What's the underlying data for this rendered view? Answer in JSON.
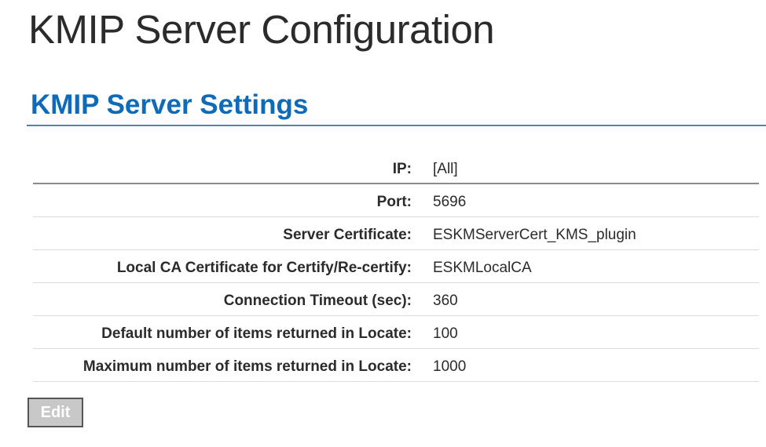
{
  "page": {
    "title": "KMIP Server Configuration"
  },
  "section": {
    "heading": "KMIP Server Settings"
  },
  "settings": [
    {
      "label": "IP:",
      "value": "[All]"
    },
    {
      "label": "Port:",
      "value": "5696"
    },
    {
      "label": "Server Certificate:",
      "value": "ESKMServerCert_KMS_plugin"
    },
    {
      "label": "Local CA Certificate for Certify/Re-certify:",
      "value": "ESKMLocalCA"
    },
    {
      "label": "Connection Timeout (sec):",
      "value": "360"
    },
    {
      "label": "Default number of items returned in Locate:",
      "value": "100"
    },
    {
      "label": "Maximum number of items returned in Locate:",
      "value": "1000"
    }
  ],
  "actions": {
    "edit_label": "Edit",
    "edit_disabled": true
  },
  "colors": {
    "heading_blue": "#0f6ab7",
    "text": "#2b2b2b",
    "rule": "#5b7fa9",
    "button_bg": "#c8c8c8"
  }
}
